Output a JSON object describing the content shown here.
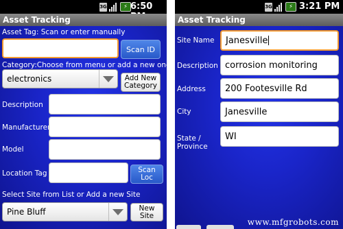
{
  "left_screen": {
    "status_time": "6:50 PM",
    "app_title": "Asset Tracking",
    "asset_tag_label": "Asset Tag: Scan or enter manually",
    "asset_tag_value": "",
    "scan_id_label": "Scan ID",
    "category_label": "Category:Choose from menu or add a new one",
    "category_value": "electronics",
    "add_category_label": "Add New Category",
    "description_label": "Description",
    "manufacturer_label": "Manufacturer",
    "model_label": "Model",
    "location_tag_label": "Location Tag",
    "scan_loc_label": "Scan Loc",
    "site_prompt_label": "Select Site from List or Add a new Site",
    "site_value": "Pine Bluff",
    "new_site_label": "New Site"
  },
  "right_screen": {
    "status_time": "3:21 PM",
    "app_title": "Asset Tracking",
    "site_name_label": "Site Name",
    "site_name_value": "Janesville",
    "description_label": "Description",
    "description_value": "corrosion monitoring",
    "address_label": "Address",
    "address_value": "200 Footesville Rd",
    "city_label": "City",
    "city_value": "Janesville",
    "state_label": "State / Province",
    "state_value": "WI"
  },
  "watermark": "www.mfgrobots.com",
  "icons": {
    "network": "3g-icon",
    "signal": "signal-bars-icon",
    "battery": "battery-charging-icon"
  },
  "colors": {
    "background_blue": "#1a25c9",
    "focus_border": "#f39a2f",
    "button_blue": "#2859c9"
  }
}
